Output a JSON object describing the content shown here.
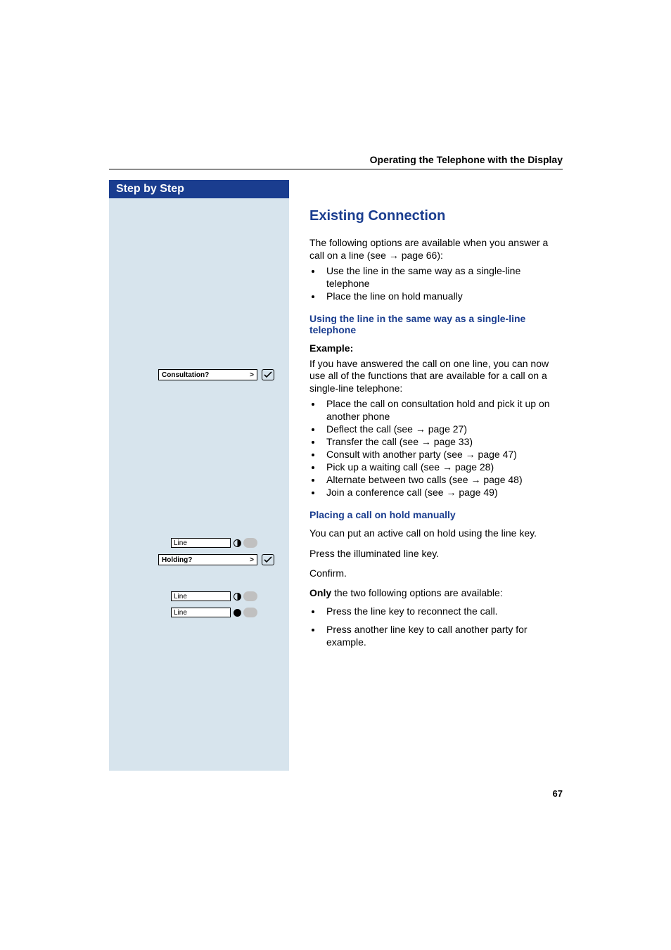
{
  "header": {
    "running_title": "Operating the Telephone with the Display"
  },
  "sidebar": {
    "title": "Step by Step",
    "prompts": {
      "consultation": "Consultation?",
      "holding": "Holding?"
    },
    "keys": {
      "line1": "Line",
      "line2": "Line",
      "line3": "Line"
    }
  },
  "content": {
    "h2": "Existing Connection",
    "intro": "The following options are available when you answer a call on a line (see ",
    "intro_xref": "page 66",
    "intro_tail": "):",
    "intro_bullets": [
      "Use the line in the same way as a single-line telephone",
      "Place the line on hold manually"
    ],
    "sub1": "Using the line in the same way as a single-line telephone",
    "example_label": "Example:",
    "example_intro": "If you have answered the call on one line, you can now use all of the functions that are available for a call on a single-line telephone:",
    "example_bullets": [
      {
        "text": "Place the call on consultation hold and pick it up on another phone",
        "xref": ""
      },
      {
        "text": "Deflect the call (see ",
        "xref": "page 27",
        "tail": ")"
      },
      {
        "text": "Transfer the call (see ",
        "xref": "page 33",
        "tail": ")"
      },
      {
        "text": "Consult with another party (see ",
        "xref": "page 47",
        "tail": ")"
      },
      {
        "text": "Pick up a waiting call (see ",
        "xref": "page 28",
        "tail": ")"
      },
      {
        "text": "Alternate between two calls (see ",
        "xref": "page 48",
        "tail": ")"
      },
      {
        "text": "Join a conference call (see ",
        "xref": "page 49",
        "tail": ")"
      }
    ],
    "sub2": "Placing a call on hold manually",
    "hold_intro": "You can put an active call on hold using the line key.",
    "press_illuminated": "Press the illuminated line key.",
    "confirm": "Confirm.",
    "only_prefix": "Only",
    "only_rest": " the two following options are available:",
    "options": [
      "Press the line key to reconnect the call.",
      "Press another line key to call another party for example."
    ]
  },
  "page_number": "67"
}
